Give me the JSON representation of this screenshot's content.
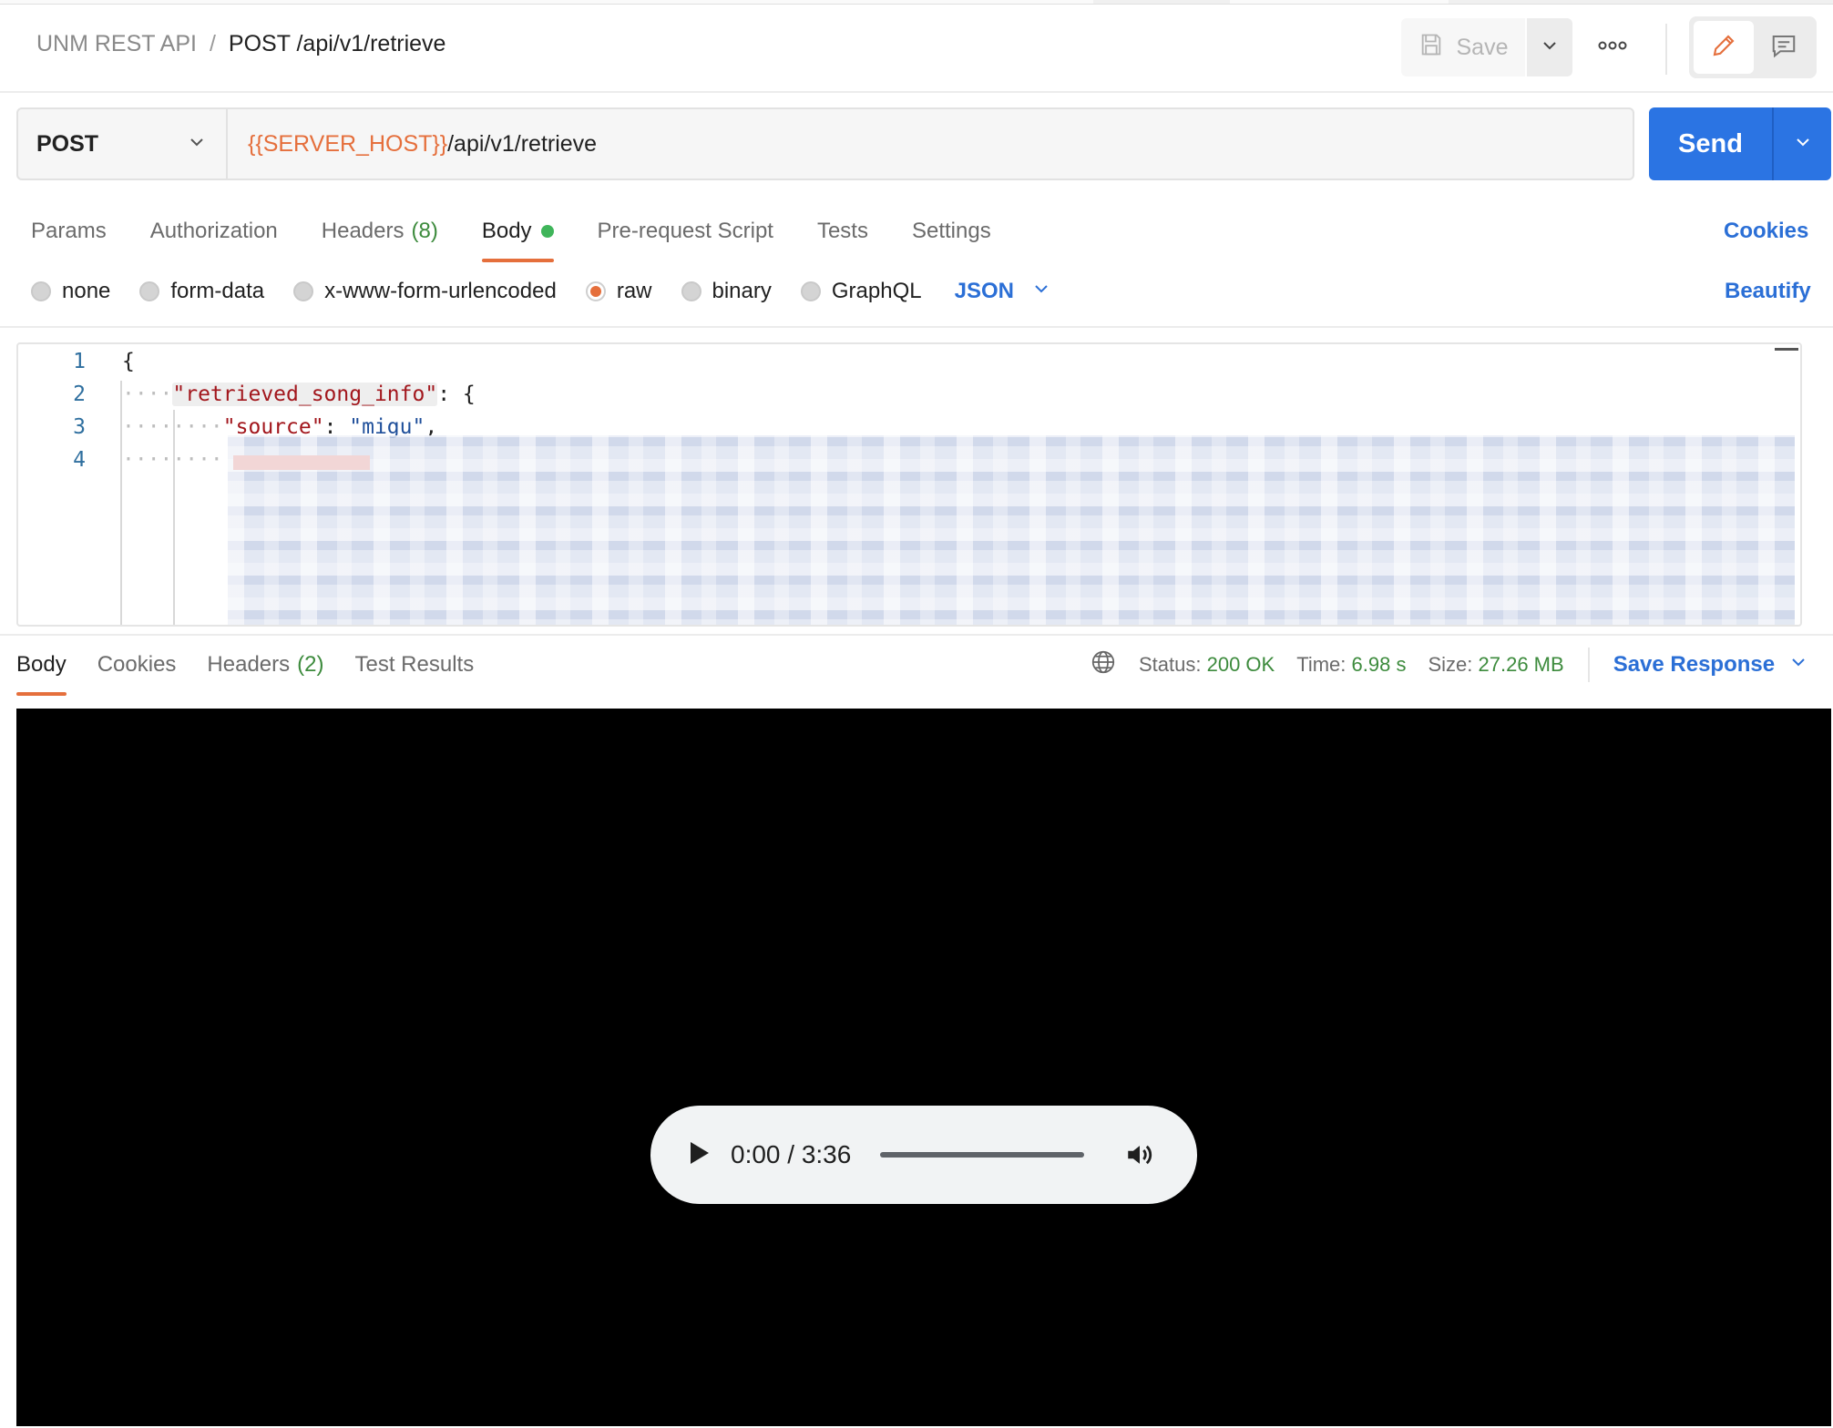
{
  "breadcrumb": {
    "collection": "UNM REST API",
    "separator": "/",
    "request": "POST /api/v1/retrieve"
  },
  "header": {
    "save_label": "Save"
  },
  "request": {
    "method": "POST",
    "url_variable": "{{SERVER_HOST}}",
    "url_path": "/api/v1/retrieve",
    "send_label": "Send"
  },
  "request_tabs": [
    {
      "label": "Params",
      "count": ""
    },
    {
      "label": "Authorization",
      "count": ""
    },
    {
      "label": "Headers",
      "count": "(8)"
    },
    {
      "label": "Body",
      "count": "",
      "active": true
    },
    {
      "label": "Pre-request Script",
      "count": ""
    },
    {
      "label": "Tests",
      "count": ""
    },
    {
      "label": "Settings",
      "count": ""
    }
  ],
  "cookies_label": "Cookies",
  "body_types": {
    "options": [
      "none",
      "form-data",
      "x-www-form-urlencoded",
      "raw",
      "binary",
      "GraphQL"
    ],
    "selected": "raw",
    "format": "JSON",
    "beautify_label": "Beautify"
  },
  "editor": {
    "lines": [
      {
        "num": "1",
        "text": "{"
      },
      {
        "num": "2",
        "key": "\"retrieved_song_info\"",
        "rest": ": {"
      },
      {
        "num": "3",
        "key": "\"source\"",
        "colon": ": ",
        "value": "\"migu\"",
        "rest": ","
      },
      {
        "num": "4",
        "text": ""
      }
    ]
  },
  "response_tabs": [
    {
      "label": "Body",
      "count": "",
      "active": true
    },
    {
      "label": "Cookies",
      "count": ""
    },
    {
      "label": "Headers",
      "count": "(2)"
    },
    {
      "label": "Test Results",
      "count": ""
    }
  ],
  "response_meta": {
    "status_label": "Status:",
    "status_value": "200 OK",
    "time_label": "Time:",
    "time_value": "6.98 s",
    "size_label": "Size:",
    "size_value": "27.26 MB",
    "save_response_label": "Save Response"
  },
  "audio_player": {
    "time": "0:00 / 3:36"
  },
  "colors": {
    "accent": "#e56f3c",
    "primary": "#2b74e3",
    "link": "#2b6fd6",
    "success": "#3d8b3d"
  }
}
